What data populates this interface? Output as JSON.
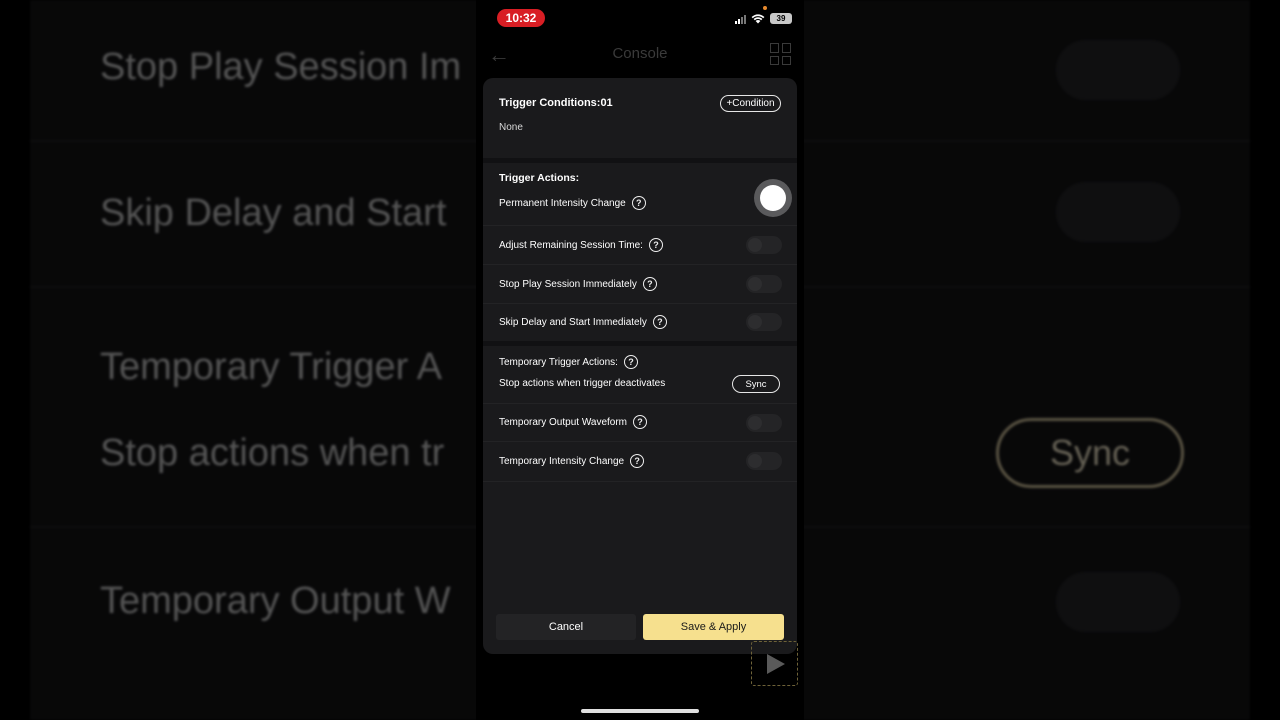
{
  "status_bar": {
    "time": "10:32",
    "battery": "39"
  },
  "nav": {
    "back_icon": "arrow-left-icon",
    "title": "Console",
    "grid_icon": "grid-icon"
  },
  "background": {
    "row1": "Stop Play Session Im",
    "row2": "Skip Delay and Start",
    "row3": "Temporary Trigger A",
    "row4": "Stop actions when tr",
    "row5": "Temporary Output W",
    "sync": "Sync"
  },
  "modal": {
    "conditions_title": "Trigger Conditions:01",
    "add_condition": "+Condition",
    "conditions_value": "None",
    "actions_title": "Trigger Actions:",
    "actions": [
      {
        "label": "Permanent Intensity Change",
        "enabled": true
      },
      {
        "label": "Adjust Remaining Session Time:",
        "enabled": false
      },
      {
        "label": "Stop Play Session Immediately",
        "enabled": false
      },
      {
        "label": "Skip Delay and Start Immediately",
        "enabled": false
      }
    ],
    "temporary_title": "Temporary Trigger Actions:",
    "stop_text": "Stop actions when trigger deactivates",
    "sync_label": "Sync",
    "temporary_actions": [
      {
        "label": "Temporary Output Waveform",
        "enabled": false
      },
      {
        "label": "Temporary Intensity Change",
        "enabled": false
      }
    ],
    "help_glyph": "?",
    "cancel_label": "Cancel",
    "save_label": "Save & Apply"
  },
  "colors": {
    "accent": "#f6e08e",
    "status_red": "#d81e24",
    "modal_bg": "#1a1a1c"
  }
}
